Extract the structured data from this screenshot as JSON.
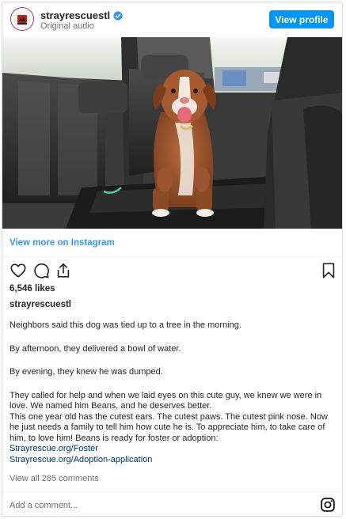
{
  "header": {
    "username": "strayrescuestl",
    "subtitle": "Original audio",
    "view_profile_label": "View profile",
    "avatar_icon": "strayrescue-logo-avatar",
    "verified_icon": "verified-badge-icon"
  },
  "media": {
    "photo_icon": "dog-in-car-photo"
  },
  "view_more_label": "View more on Instagram",
  "actions": {
    "like_icon": "heart-icon",
    "comment_icon": "comment-icon",
    "share_icon": "share-icon",
    "save_icon": "bookmark-icon"
  },
  "likes": "6,546 likes",
  "caption": {
    "username": "strayrescuestl",
    "p1": "Neighbors said this dog was tied up to a tree in the morning.",
    "p2": "By afternoon, they delivered a bowl of water.",
    "p3": "By evening, they knew he was dumped.",
    "p4a": "They called for help and when we laid eyes on this cute guy, we knew we were in love. We named him Beans, and he deserves better.",
    "p4b": "This one year old has the cutest ears. The cutest paws. The cutest pink nose. Now he just needs a family to tell him how cute he is. To appreciate him, to take care of him, to love him! Beans is ready for foster or adoption:",
    "link1": "Strayrescue.org/Foster",
    "link2": "Strayrescue.org/Adoption-application"
  },
  "view_comments": "View all 285 comments",
  "comment_placeholder": "Add a comment...",
  "instagram_icon": "instagram-logo-icon",
  "colors": {
    "accent": "#0095f6",
    "link": "#3897f0",
    "caption_link": "#00376b",
    "muted": "#737373"
  }
}
